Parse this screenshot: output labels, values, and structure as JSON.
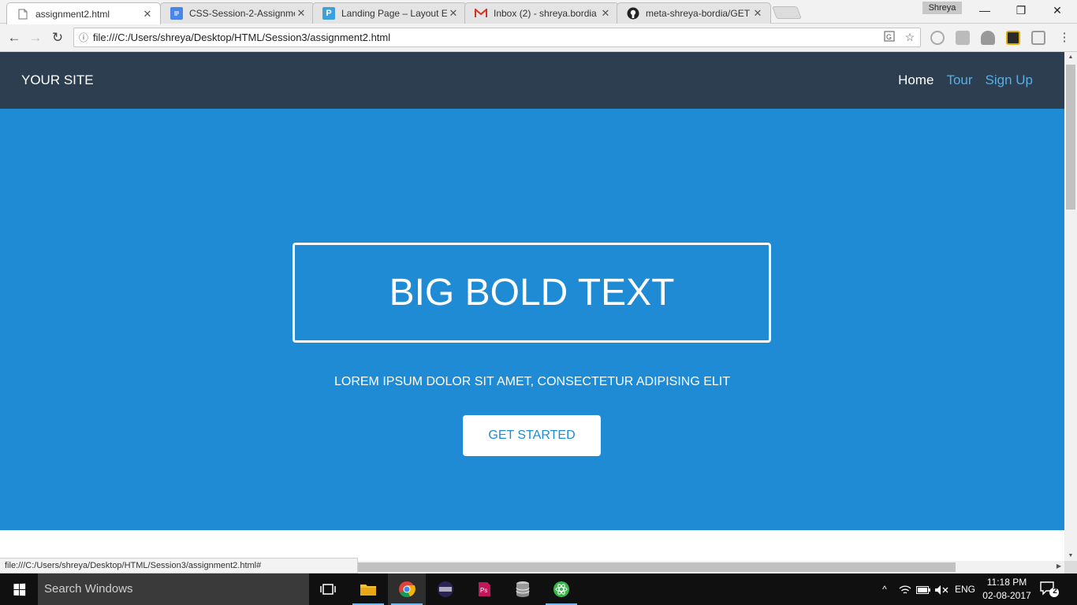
{
  "browser": {
    "tabs": [
      {
        "title": "assignment2.html",
        "favicon": "page-icon",
        "active": true
      },
      {
        "title": "CSS-Session-2-Assignme",
        "favicon": "google-docs-icon",
        "active": false
      },
      {
        "title": "Landing Page – Layout E",
        "favicon": "p-icon",
        "active": false
      },
      {
        "title": "Inbox (2) - shreya.bordia",
        "favicon": "gmail-icon",
        "active": false
      },
      {
        "title": "meta-shreya-bordia/GET",
        "favicon": "github-icon",
        "active": false
      }
    ],
    "profile_name": "Shreya",
    "address": "file:///C:/Users/shreya/Desktop/HTML/Session3/assignment2.html",
    "status_url": "file:///C:/Users/shreya/Desktop/HTML/Session3/assignment2.html#"
  },
  "site": {
    "brand": "YOUR SITE",
    "nav": [
      {
        "label": "Home"
      },
      {
        "label": "Tour"
      },
      {
        "label": "Sign Up"
      }
    ],
    "hero": {
      "headline": "BIG BOLD TEXT",
      "subtitle": "LOREM IPSUM DOLOR SIT AMET, CONSECTETUR ADIPISING ELIT",
      "cta": "GET STARTED"
    }
  },
  "colors": {
    "header_bg": "#2c3e50",
    "hero_bg": "#1e8bd4",
    "nav_link": "#5dade2"
  },
  "taskbar": {
    "search_placeholder": "Search Windows",
    "language": "ENG",
    "time": "11:18 PM",
    "date": "02-08-2017",
    "notification_count": "2"
  }
}
